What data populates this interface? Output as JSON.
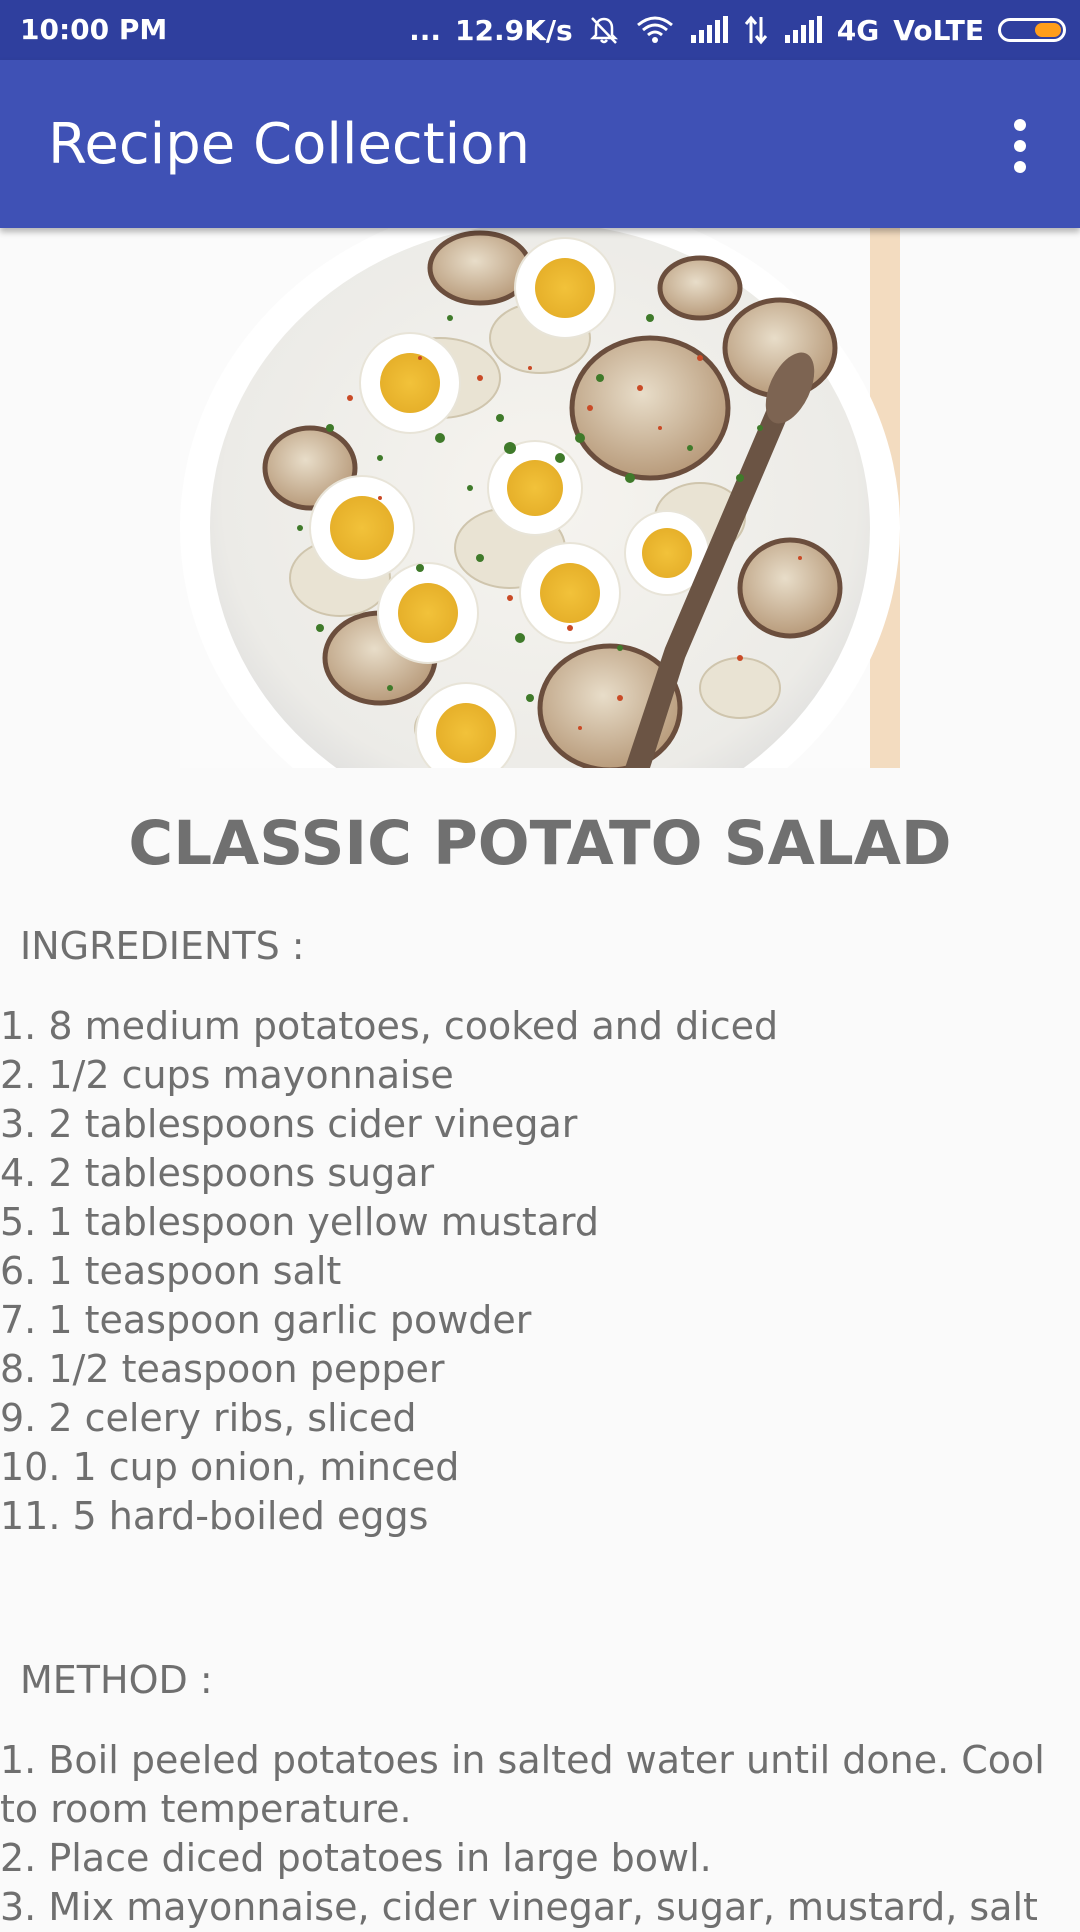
{
  "status_bar": {
    "time": "10:00 PM",
    "dots": "...",
    "speed": "12.9K/s",
    "network": "4G",
    "volte": "VoLTE",
    "icons": [
      "mute-bell-icon",
      "wifi-icon",
      "signal-icon",
      "data-arrows-icon",
      "signal-icon",
      "battery-icon"
    ],
    "battery_level": 0.45
  },
  "app_bar": {
    "title": "Recipe Collection",
    "overflow_icon": "more-vert-icon",
    "color": "#3f51b5"
  },
  "recipe": {
    "title": "CLASSIC POTATO SALAD",
    "ingredients_label": "INGREDIENTS :",
    "ingredients": [
      "1. 8 medium potatoes, cooked and diced",
      "2. 1/2 cups mayonnaise",
      "3. 2 tablespoons cider vinegar",
      "4. 2 tablespoons sugar",
      "5. 1 tablespoon yellow mustard",
      "6. 1 teaspoon salt",
      "7. 1 teaspoon garlic powder",
      "8. 1/2 teaspoon pepper",
      "9. 2 celery ribs, sliced",
      "10. 1 cup onion, minced",
      "11. 5 hard-boiled eggs"
    ],
    "method_label": "METHOD :",
    "method": [
      "1. Boil peeled potatoes in salted water until done. Cool to room temperature.",
      "2. Place diced potatoes in large bowl.",
      "3. Mix mayonnaise, cider vinegar, sugar, mustard, salt"
    ]
  }
}
